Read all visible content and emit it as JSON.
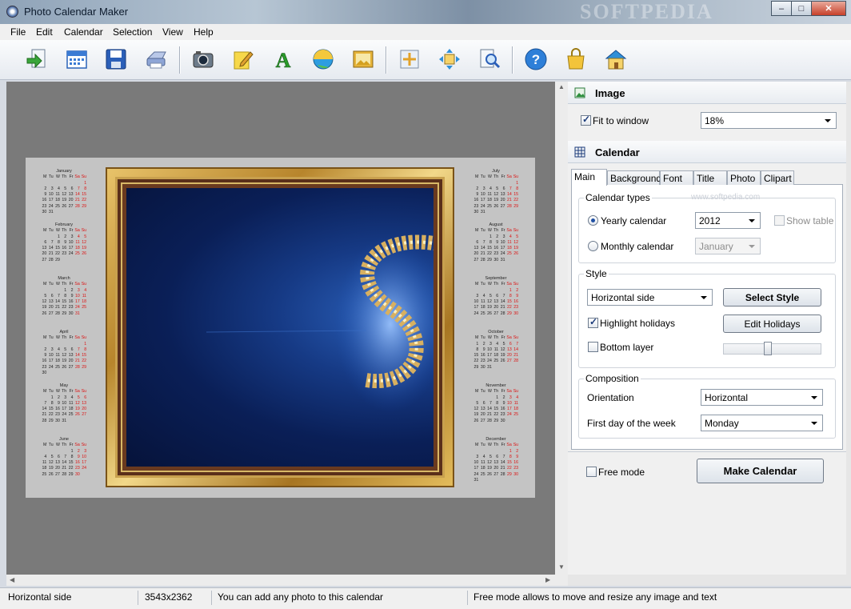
{
  "window": {
    "title": "Photo Calendar Maker",
    "watermark": "SOFTPEDIA",
    "min": "–",
    "max": "□",
    "close": "✕"
  },
  "menu": [
    "File",
    "Edit",
    "Calendar",
    "Selection",
    "View",
    "Help"
  ],
  "toolbar": {
    "icons": [
      "open-icon",
      "calendar-icon",
      "save-icon",
      "print-icon",
      "camera-icon",
      "edit-note-icon",
      "text-icon",
      "ball-icon",
      "image-frame-icon",
      "fit-icon",
      "move-icon",
      "zoom-icon",
      "help-icon",
      "bag-icon",
      "house-icon"
    ]
  },
  "preview": {
    "weekdays": [
      "M",
      "Tu",
      "W",
      "Th",
      "Fr",
      "Sa",
      "Su"
    ],
    "months": [
      {
        "name": "January",
        "start": 6,
        "days": 31
      },
      {
        "name": "February",
        "start": 2,
        "days": 29
      },
      {
        "name": "March",
        "start": 3,
        "days": 31
      },
      {
        "name": "April",
        "start": 6,
        "days": 30
      },
      {
        "name": "May",
        "start": 1,
        "days": 31
      },
      {
        "name": "June",
        "start": 4,
        "days": 30
      },
      {
        "name": "July",
        "start": 6,
        "days": 31
      },
      {
        "name": "August",
        "start": 2,
        "days": 31
      },
      {
        "name": "September",
        "start": 5,
        "days": 30
      },
      {
        "name": "October",
        "start": 0,
        "days": 31
      },
      {
        "name": "November",
        "start": 3,
        "days": 30
      },
      {
        "name": "December",
        "start": 5,
        "days": 31
      }
    ]
  },
  "image_section": {
    "title": "Image",
    "fit_to_window": {
      "label": "Fit to window",
      "checked": true
    },
    "zoom": "18%"
  },
  "calendar_section": {
    "title": "Calendar",
    "tabs": [
      "Main",
      "Background",
      "Font",
      "Title",
      "Photo",
      "Clipart"
    ],
    "active_tab": "Main",
    "calendar_types": {
      "title": "Calendar types",
      "yearly_label": "Yearly calendar",
      "year": "2012",
      "show_table": "Show table",
      "monthly_label": "Monthly calendar",
      "month": "January",
      "watermark": "www.softpedia.com"
    },
    "style": {
      "title": "Style",
      "style_value": "Horizontal side",
      "select_style": "Select Style",
      "highlight_holidays": "Highlight holidays",
      "edit_holidays": "Edit Holidays",
      "bottom_layer": "Bottom layer",
      "slider_level": 0.45
    },
    "composition": {
      "title": "Composition",
      "orientation_label": "Orientation",
      "orientation_value": "Horizontal",
      "first_day_label": "First day of the week",
      "first_day_value": "Monday"
    }
  },
  "bottom": {
    "free_mode": "Free mode",
    "make_calendar": "Make Calendar"
  },
  "status": {
    "style": "Horizontal side",
    "size": "3543x2362",
    "hint": "You can add any photo to this calendar",
    "free_hint": "Free mode allows to move and resize any image and text"
  }
}
